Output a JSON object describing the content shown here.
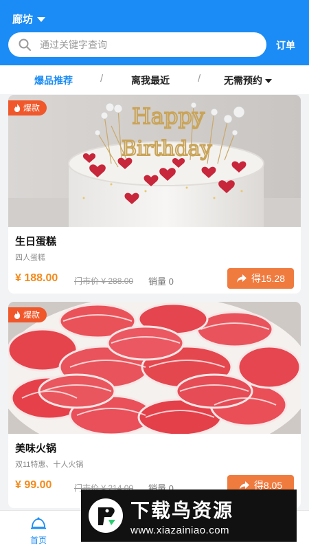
{
  "header": {
    "city": "廊坊",
    "search_placeholder": "通过关键字查询",
    "orders_label": "订单",
    "accent": "#1b8cf5"
  },
  "filters": [
    {
      "label": "爆品推荐",
      "active": true
    },
    {
      "label": "离我最近",
      "active": false
    },
    {
      "label": "无需预约",
      "active": false
    }
  ],
  "filter_separator": "/",
  "products": [
    {
      "badge": "爆款",
      "name": "生日蛋糕",
      "desc": "四人蛋糕",
      "price": "¥ 188.00",
      "original_price": "门市价 ¥ 288.00",
      "sales": "销量 0",
      "earn": "得15.28",
      "topper_text": [
        "Happy",
        "Birthday"
      ]
    },
    {
      "badge": "爆款",
      "name": "美味火锅",
      "desc": "双11特惠、十人火锅",
      "price": "¥ 99.00",
      "original_price": "门市价 ¥ 214.00",
      "sales": "销量 0",
      "earn": "得8.05"
    }
  ],
  "tabbar": {
    "items": [
      {
        "label": "首页",
        "icon": "home-icon",
        "active": true
      }
    ]
  },
  "watermark": {
    "title": "下载鸟资源",
    "url": "www.xiazainiao.com"
  }
}
